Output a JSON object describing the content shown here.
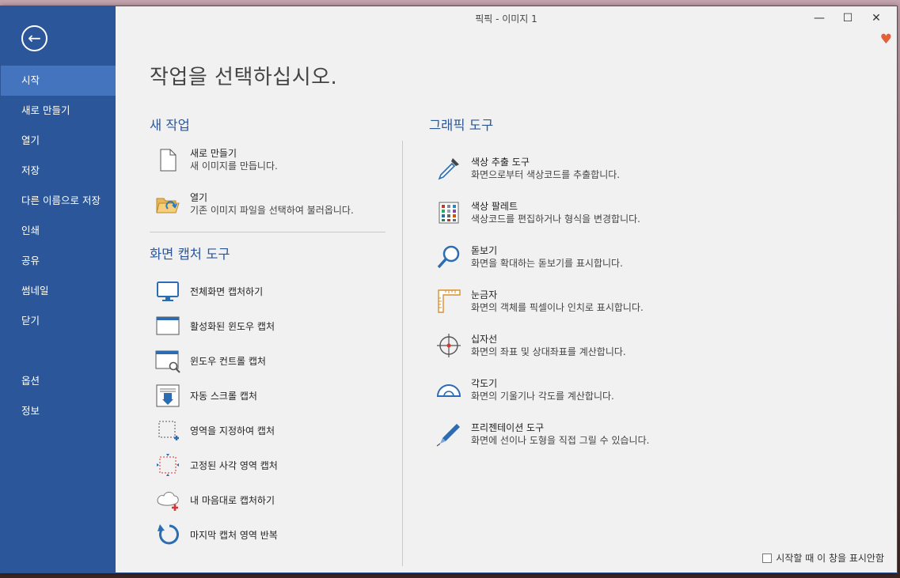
{
  "window": {
    "title": "픽픽 - 이미지 1"
  },
  "sidebar": {
    "items": [
      {
        "label": "시작"
      },
      {
        "label": "새로 만들기"
      },
      {
        "label": "열기"
      },
      {
        "label": "저장"
      },
      {
        "label": "다른 이름으로 저장"
      },
      {
        "label": "인쇄"
      },
      {
        "label": "공유"
      },
      {
        "label": "썸네일"
      },
      {
        "label": "닫기"
      },
      {
        "label": "옵션"
      },
      {
        "label": "정보"
      }
    ],
    "active_index": 0
  },
  "main": {
    "page_title": "작업을 선택하십시오.",
    "new_task": {
      "title": "새 작업",
      "items": [
        {
          "title": "새로 만들기",
          "desc": "새 이미지를 만듭니다.",
          "icon": "blank-page-icon"
        },
        {
          "title": "열기",
          "desc": "기존 이미지 파일을 선택하여 불러옵니다.",
          "icon": "open-folder-icon"
        }
      ]
    },
    "capture_tools": {
      "title": "화면 캡처 도구",
      "items": [
        {
          "label": "전체화면 캡처하기",
          "icon": "monitor-icon"
        },
        {
          "label": "활성화된 윈도우 캡처",
          "icon": "active-window-icon"
        },
        {
          "label": "윈도우 컨트롤 캡처",
          "icon": "window-control-icon"
        },
        {
          "label": "자동 스크롤 캡처",
          "icon": "scroll-capture-icon"
        },
        {
          "label": "영역을 지정하여 캡처",
          "icon": "region-capture-icon"
        },
        {
          "label": "고정된 사각 영역 캡처",
          "icon": "fixed-region-icon"
        },
        {
          "label": "내 마음대로 캡처하기",
          "icon": "freehand-capture-icon"
        },
        {
          "label": "마지막 캡처 영역 반복",
          "icon": "repeat-capture-icon"
        }
      ]
    },
    "graphic_tools": {
      "title": "그래픽 도구",
      "items": [
        {
          "title": "색상 추출 도구",
          "desc": "화면으로부터 색상코드를 추출합니다.",
          "icon": "eyedropper-icon"
        },
        {
          "title": "색상 팔레트",
          "desc": "색상코드를 편집하거나 형식을 변경합니다.",
          "icon": "palette-icon"
        },
        {
          "title": "돋보기",
          "desc": "화면을 확대하는 돋보기를 표시합니다.",
          "icon": "magnifier-icon"
        },
        {
          "title": "눈금자",
          "desc": "화면의 객체를 픽셀이나 인치로 표시합니다.",
          "icon": "ruler-icon"
        },
        {
          "title": "십자선",
          "desc": "화면의 좌표 및 상대좌표를 계산합니다.",
          "icon": "crosshair-icon"
        },
        {
          "title": "각도기",
          "desc": "화면의 기울기나 각도를 계산합니다.",
          "icon": "protractor-icon"
        },
        {
          "title": "프리젠테이션 도구",
          "desc": "화면에 선이나 도형을 직접 그릴 수 있습니다.",
          "icon": "pen-icon"
        }
      ]
    },
    "footer": {
      "checkbox_label": "시작할 때 이 창을 표시안함",
      "checked": false
    }
  },
  "colors": {
    "sidebar": "#2b579a",
    "sidebar_active": "#4474bd",
    "accent": "#2b579a",
    "heart": "#e0613a"
  }
}
